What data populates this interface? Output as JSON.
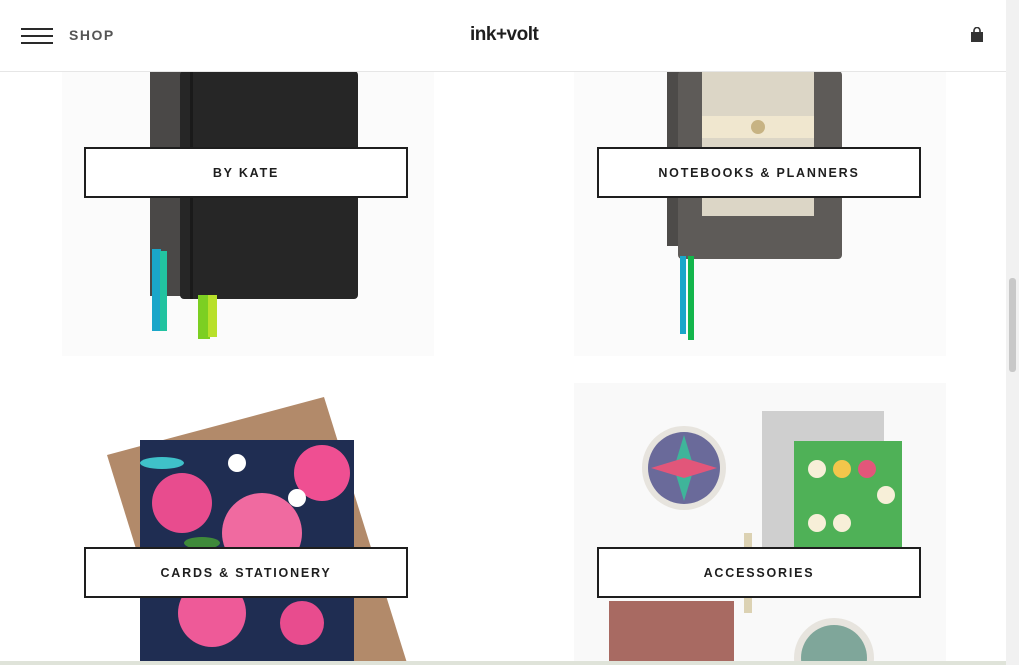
{
  "header": {
    "menu_icon": "hamburger-menu-icon",
    "shop_label": "SHOP",
    "logo_text": "ink+volt",
    "cart_icon": "shopping-bag-icon"
  },
  "categories": [
    {
      "label": "BY KATE"
    },
    {
      "label": "NOTEBOOKS & PLANNERS"
    },
    {
      "label": "CARDS & STATIONERY"
    },
    {
      "label": "ACCESSORIES"
    }
  ],
  "colors": {
    "text": "#1e1e1e",
    "muted": "#555555",
    "border": "#e6e6e6",
    "background": "#ffffff"
  }
}
